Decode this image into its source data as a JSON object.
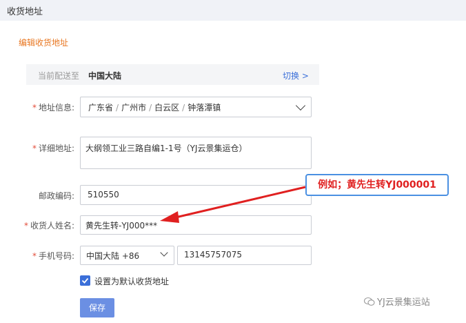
{
  "header": {
    "title": "收货地址"
  },
  "section": {
    "title": "编辑收货地址"
  },
  "shipping": {
    "label": "当前配送至",
    "value": "中国大陆",
    "switch": "切换 >"
  },
  "form": {
    "address_info": {
      "label": "地址信息:",
      "province": "广东省",
      "city": "广州市",
      "district": "白云区",
      "town": "钟落潭镇",
      "separator": "/"
    },
    "detail": {
      "label": "详细地址:",
      "value": "大纲领工业三路自编1-1号（YJ云景集运仓）"
    },
    "postal": {
      "label": "邮政编码:",
      "value": "510550"
    },
    "recipient": {
      "label": "收货人姓名:",
      "value": "黄先生转-YJ000***"
    },
    "phone": {
      "label": "手机号码:",
      "region": "中国大陆 +86",
      "number": "13145757075"
    },
    "required_mark": "*",
    "default_checkbox": {
      "label": "设置为默认收货地址",
      "checked": true
    },
    "save_label": "保存"
  },
  "annotation": {
    "text": "例如；黄先生转YJ000001",
    "border_color": "#4a90e2",
    "text_color": "#e02020",
    "arrow_color": "#e02020"
  },
  "watermark": {
    "text": "YJ云景集运站"
  },
  "colors": {
    "accent": "#3b6fd9",
    "section_title": "#e87722",
    "required": "#e34d3b"
  }
}
